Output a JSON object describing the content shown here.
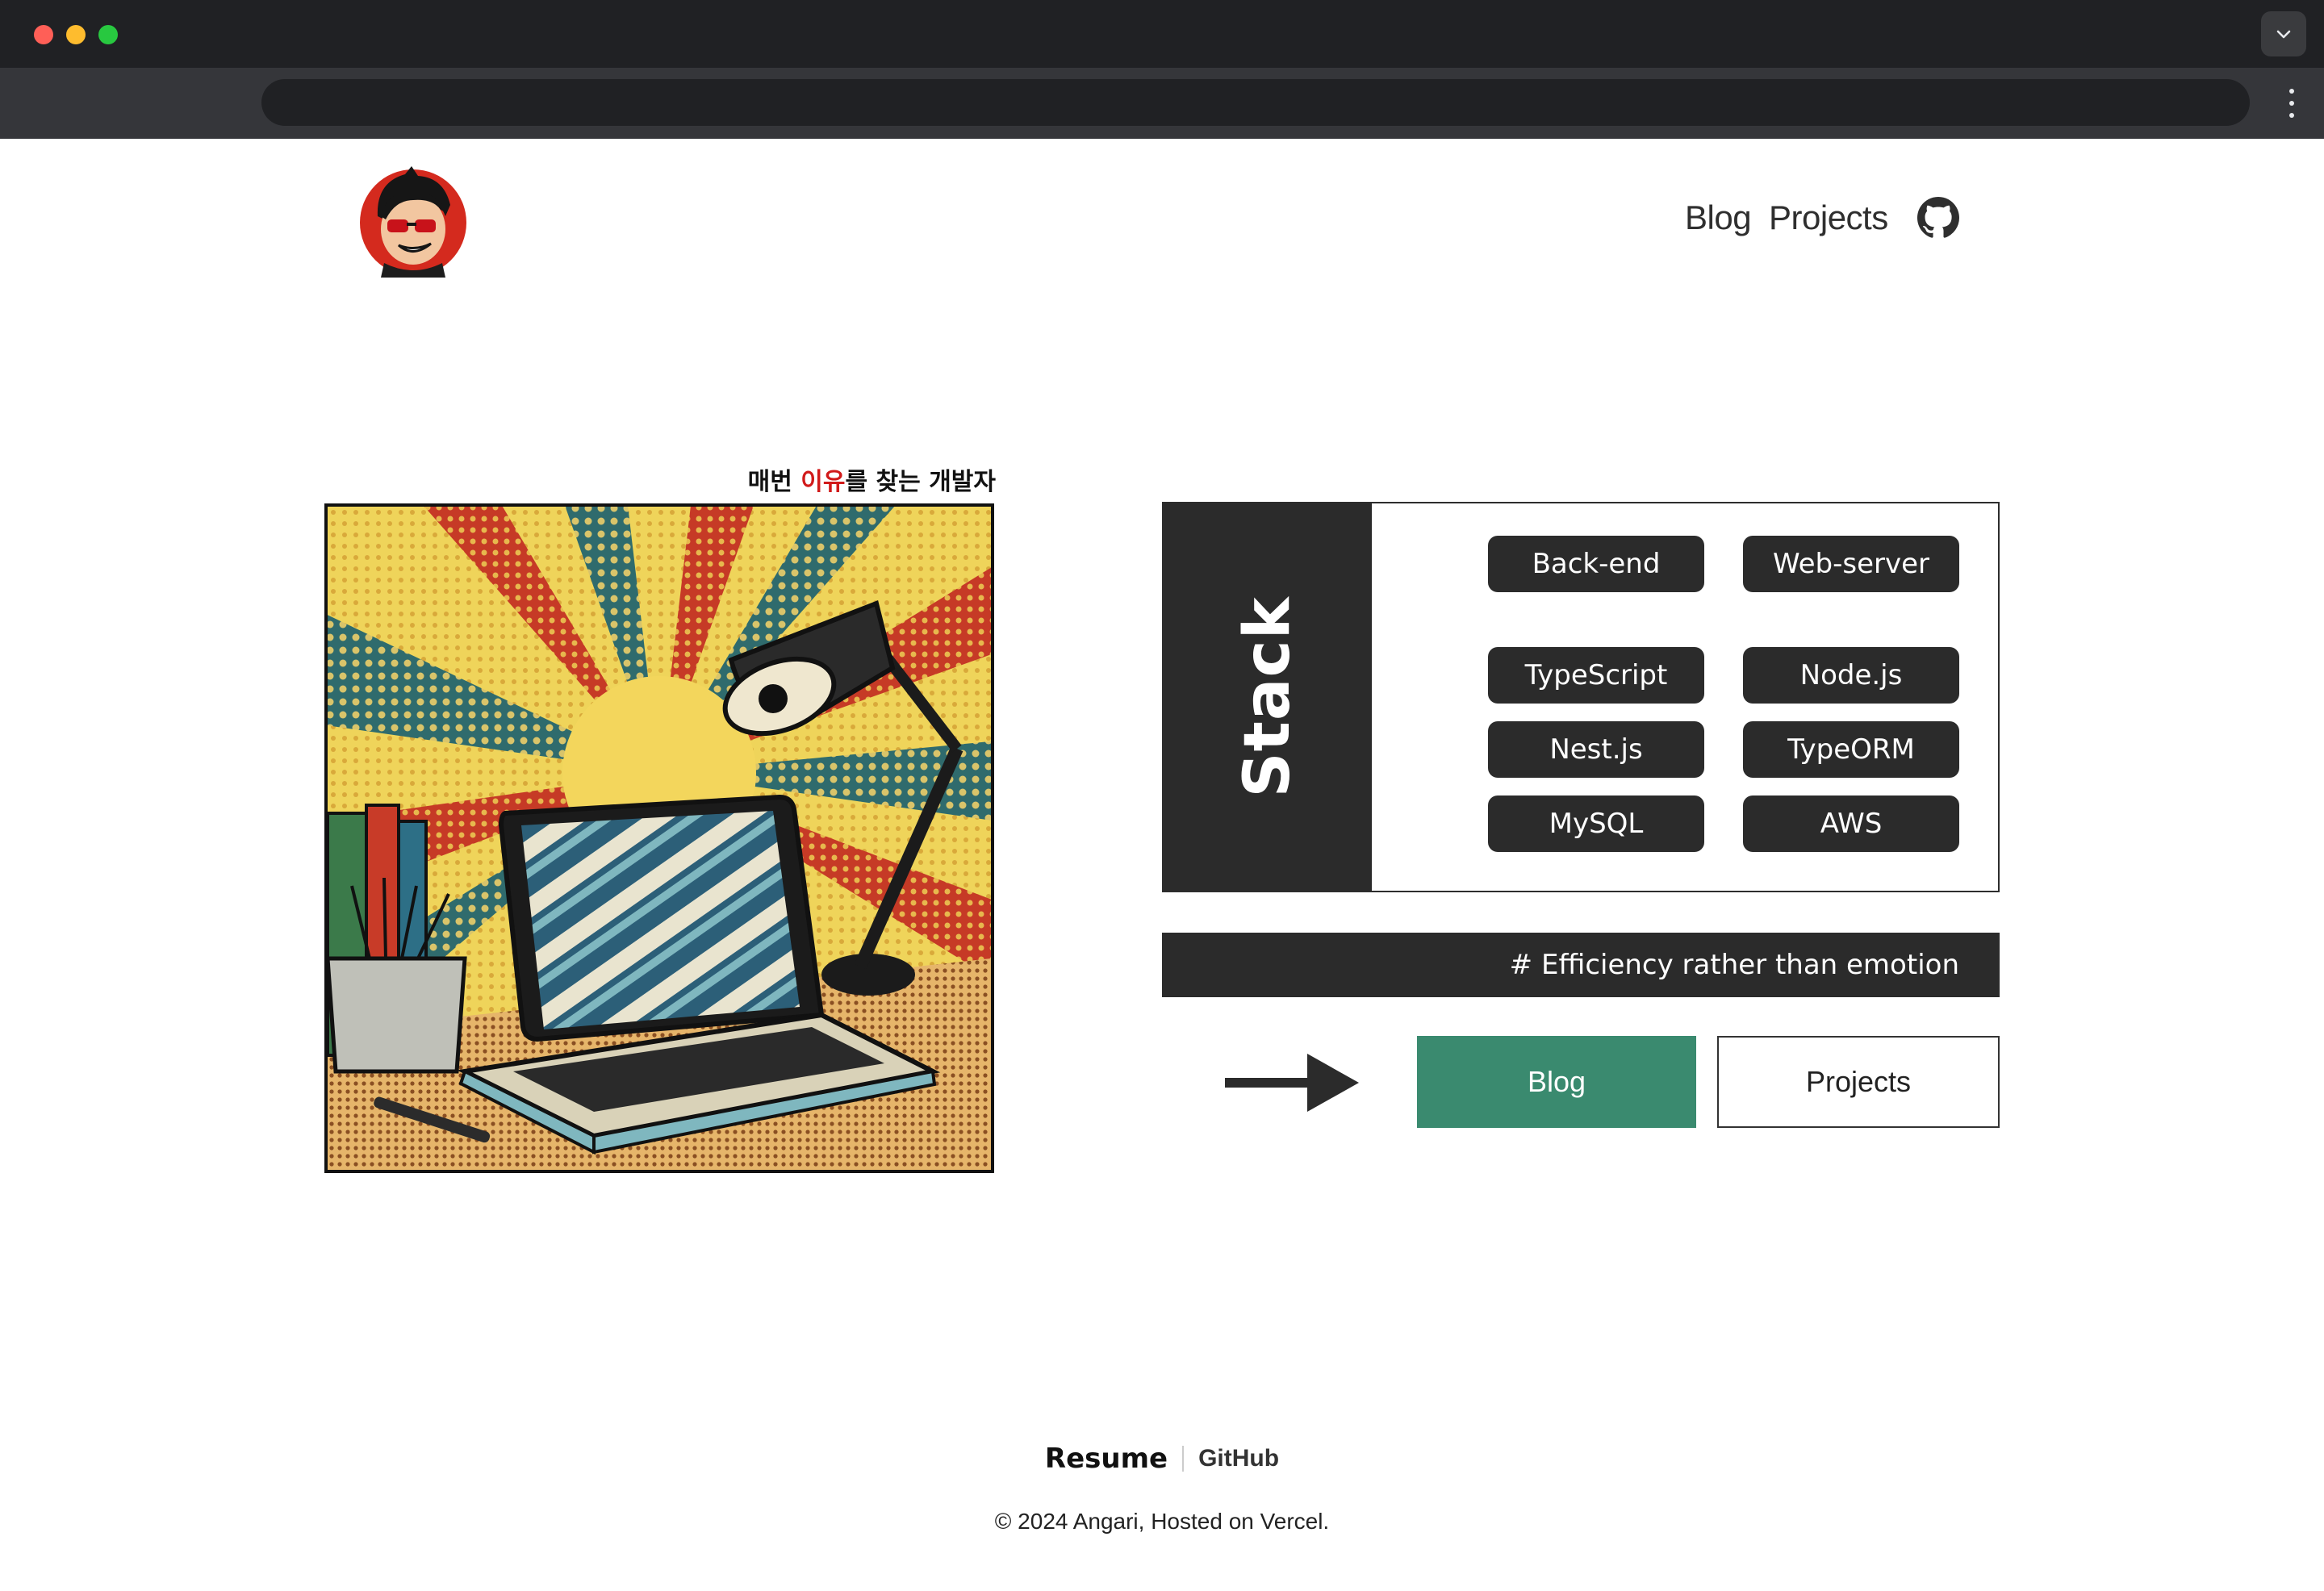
{
  "header": {
    "nav_blog": "Blog",
    "nav_projects": "Projects",
    "github_icon": "github-icon"
  },
  "hero": {
    "tagline_before": "매번 ",
    "tagline_accent": "이유",
    "tagline_after": "를 찾는 개발자",
    "accent_color": "#d11a1a"
  },
  "stack": {
    "title": "Stack",
    "items": [
      "Back-end",
      "Web-server",
      "TypeScript",
      "Node.js",
      "Nest.js",
      "TypeORM",
      "MySQL",
      "AWS"
    ]
  },
  "motto": "# Efficiency rather than emotion",
  "cta": {
    "blog_label": "Blog",
    "projects_label": "Projects",
    "blog_color": "#3a8a6f"
  },
  "footer": {
    "resume": "Resume",
    "github": "GitHub",
    "copyright": "© 2024 Angari, Hosted on Vercel."
  }
}
